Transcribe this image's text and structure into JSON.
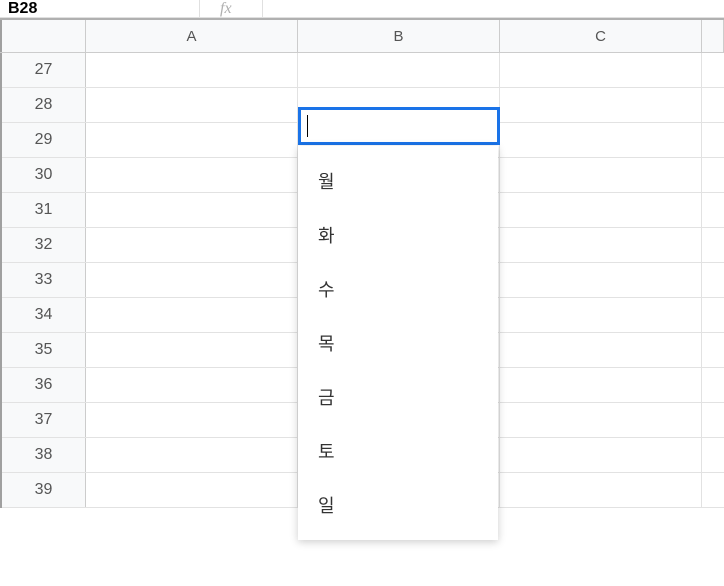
{
  "cellRef": "B28",
  "fxLabel": "fx",
  "columns": [
    "A",
    "B",
    "C"
  ],
  "rows": [
    "27",
    "28",
    "29",
    "30",
    "31",
    "32",
    "33",
    "34",
    "35",
    "36",
    "37",
    "38",
    "39"
  ],
  "activeCell": {
    "address": "B28",
    "value": ""
  },
  "dropdown": {
    "items": [
      "월",
      "화",
      "수",
      "목",
      "금",
      "토",
      "일"
    ]
  }
}
